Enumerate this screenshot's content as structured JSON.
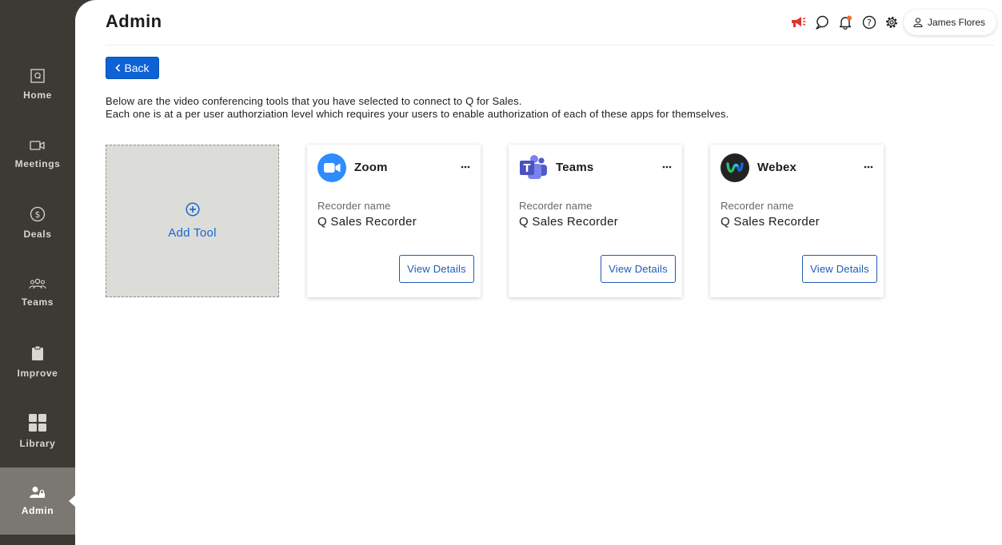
{
  "nav": {
    "items": [
      {
        "label": "Home",
        "icon": "q-icon"
      },
      {
        "label": "Meetings",
        "icon": "video-icon"
      },
      {
        "label": "Deals",
        "icon": "dollar-icon"
      },
      {
        "label": "Teams",
        "icon": "people-icon"
      },
      {
        "label": "Improve",
        "icon": "clipboard-icon"
      },
      {
        "label": "Library",
        "icon": "grid-icon"
      },
      {
        "label": "Admin",
        "icon": "user-lock-icon",
        "active": true
      }
    ]
  },
  "header": {
    "title": "Admin",
    "user_name": "James Flores",
    "icons": [
      "megaphone-icon",
      "chat-icon",
      "bell-icon",
      "help-icon",
      "gear-icon"
    ],
    "accent_color": "#e0352b"
  },
  "back_label": "Back",
  "intro": {
    "line1": "Below are the video conferencing tools that you have selected to connect to Q for Sales.",
    "line2": "Each one is at a per user authorziation level which requires your users to enable authorization of each of these apps for themselves."
  },
  "add_tool_label": "Add Tool",
  "tools": [
    {
      "name": "Zoom",
      "recorder_label": "Recorder name",
      "recorder_value": "Q Sales Recorder",
      "button_label": "View Details",
      "brand_color": "#2d8cff"
    },
    {
      "name": "Teams",
      "recorder_label": "Recorder name",
      "recorder_value": "Q Sales Recorder",
      "button_label": "View Details",
      "brand_color": "#5059c9"
    },
    {
      "name": "Webex",
      "recorder_label": "Recorder name",
      "recorder_value": "Q Sales Recorder",
      "button_label": "View Details",
      "brand_color": "#222222"
    }
  ],
  "colors": {
    "primary": "#0d63d6",
    "sidebar": "#3d3a36",
    "sidebar_active": "#7b7873"
  }
}
